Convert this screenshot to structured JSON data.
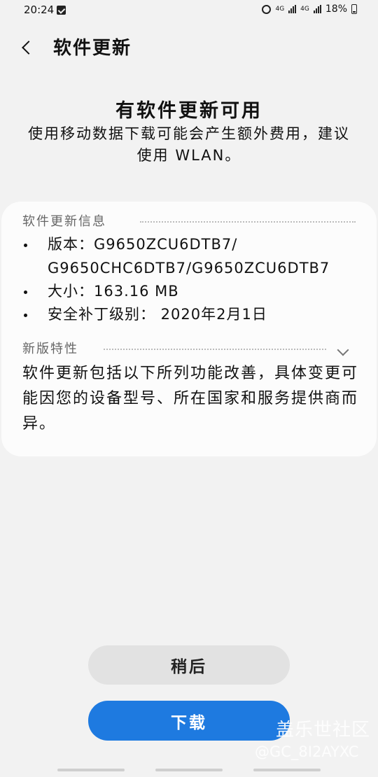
{
  "status_bar": {
    "time": "20:24",
    "network1": "4G",
    "network2": "4G",
    "battery": "18%"
  },
  "header": {
    "title": "软件更新"
  },
  "headline": "有软件更新可用",
  "subtitle": "使用移动数据下载可能会产生额外费用，建议使用 WLAN。",
  "info_section": {
    "title": "软件更新信息",
    "version_line1": "版本：G9650ZCU6DTB7/",
    "version_line2": "G9650CHC6DTB7/G9650ZCU6DTB7",
    "size": "大小：163.16 MB",
    "security_patch": "安全补丁级别： 2020年2月1日"
  },
  "features_section": {
    "title": "新版特性",
    "text": "软件更新包括以下所列功能改善，具体变更可能因您的设备型号、所在国家和服务提供商而异。"
  },
  "buttons": {
    "later": "稍后",
    "download": "下载"
  },
  "watermark": {
    "line1": "盖乐世社区",
    "line2": "@GC_8I2AYXC"
  },
  "colors": {
    "accent": "#1e7ae0",
    "background": "#f2f2f2",
    "card": "#fcfcfc"
  }
}
